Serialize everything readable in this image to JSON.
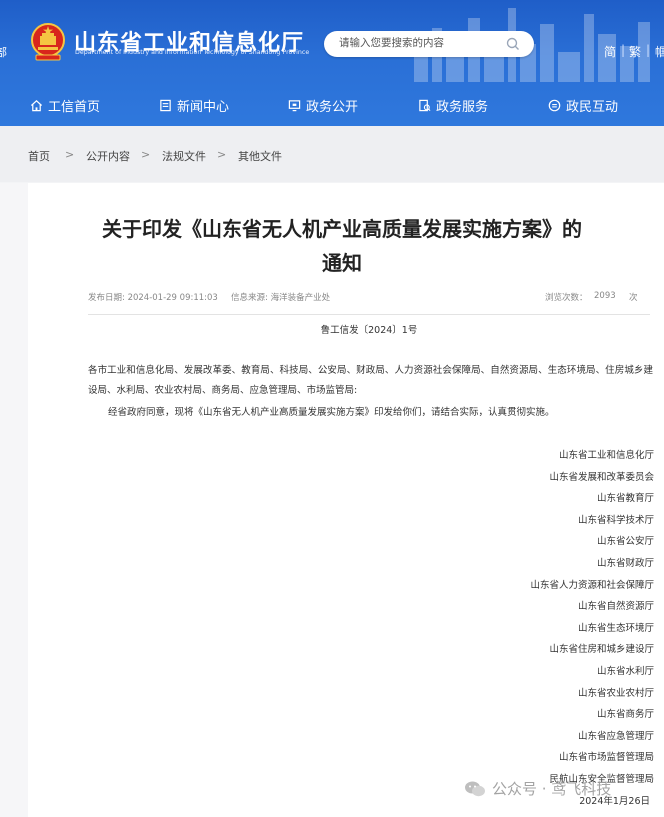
{
  "header": {
    "site_title": "山东省工业和信息化厅",
    "site_subtitle": "Department of Industry and Information Technology of Shandong Province",
    "left_edge_glyph": "部",
    "search_placeholder": "请输入您要搜索的内容",
    "lang_simplified": "简",
    "lang_traditional": "繁",
    "lang_sep": "|",
    "lang_more": "帼"
  },
  "nav": [
    {
      "label": "工信首页",
      "icon": "home-icon"
    },
    {
      "label": "新闻中心",
      "icon": "news-icon"
    },
    {
      "label": "政务公开",
      "icon": "monitor-icon"
    },
    {
      "label": "政务服务",
      "icon": "service-icon"
    },
    {
      "label": "政民互动",
      "icon": "interaction-icon"
    }
  ],
  "breadcrumb": {
    "items": [
      "首页",
      "公开内容",
      "法规文件",
      "其他文件"
    ],
    "separator": ">"
  },
  "article": {
    "title_line1": "关于印发《山东省无人机产业高质量发展实施方案》的",
    "title_line2": "通知",
    "publish_date": "发布日期: 2024-01-29 09:11:03",
    "source": "信息来源: 海洋装备产业处",
    "views_label": "浏览次数：",
    "views_count": "2093",
    "views_unit": "次",
    "doc_number": "鲁工信发〔2024〕1号",
    "recipients": "各市工业和信息化局、发展改革委、教育局、科技局、公安局、财政局、人力资源社会保障局、自然资源局、生态环境局、住房城乡建设局、水利局、农业农村局、商务局、应急管理局、市场监管局:",
    "body": "经省政府同意，现将《山东省无人机产业高质量发展实施方案》印发给你们，请结合实际，认真贯彻实施。",
    "signers": [
      "山东省工业和信息化厅",
      "山东省发展和改革委员会",
      "山东省教育厅",
      "山东省科学技术厅",
      "山东省公安厅",
      "山东省财政厅",
      "山东省人力资源和社会保障厅",
      "山东省自然资源厅",
      "山东省生态环境厅",
      "山东省住房和城乡建设厅",
      "山东省水利厅",
      "山东省农业农村厅",
      "山东省商务厅",
      "山东省应急管理厅",
      "山东省市场监督管理局",
      "民航山东安全监督管理局"
    ],
    "date": "2024年1月26日"
  },
  "watermark": {
    "text": "公众号 · 鸢飞科技"
  },
  "colors": {
    "header_blue": "#2a6fd6",
    "emblem_red": "#d8261c",
    "emblem_gold": "#f5c542"
  }
}
